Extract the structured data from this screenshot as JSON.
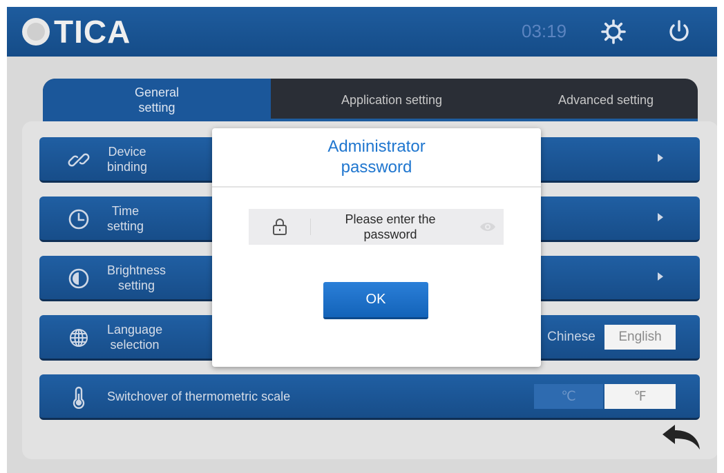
{
  "header": {
    "brand": "TICA",
    "time": "03:19",
    "icons": {
      "settings": "gear-icon",
      "power": "power-icon"
    }
  },
  "tabs": [
    {
      "label": "General\nsetting",
      "active": true
    },
    {
      "label": "Application setting",
      "active": false
    },
    {
      "label": "Advanced setting",
      "active": false
    }
  ],
  "rows": {
    "device_binding": {
      "label": "Device\nbinding",
      "icon": "link-icon"
    },
    "time_setting": {
      "label": "Time\nsetting",
      "icon": "clock-icon"
    },
    "brightness_setting": {
      "label": "Brightness\nsetting",
      "icon": "brightness-icon"
    },
    "language_selection": {
      "label": "Language\nselection",
      "icon": "globe-icon",
      "options": [
        "Chinese",
        "English"
      ],
      "selected": "English"
    },
    "temperature_scale": {
      "label": "Switchover of thermometric scale",
      "icon": "thermometer-icon",
      "options": [
        "℃",
        "℉"
      ],
      "selected": "℉"
    }
  },
  "dialog": {
    "title": "Administrator\npassword",
    "password_placeholder": "Please enter the\npassword",
    "ok_label": "OK"
  },
  "colors": {
    "header_bg": "#1a5593",
    "row_bg": "#1c5797",
    "dialog_title": "#1f76cf",
    "ok_button": "#1e70c8"
  }
}
